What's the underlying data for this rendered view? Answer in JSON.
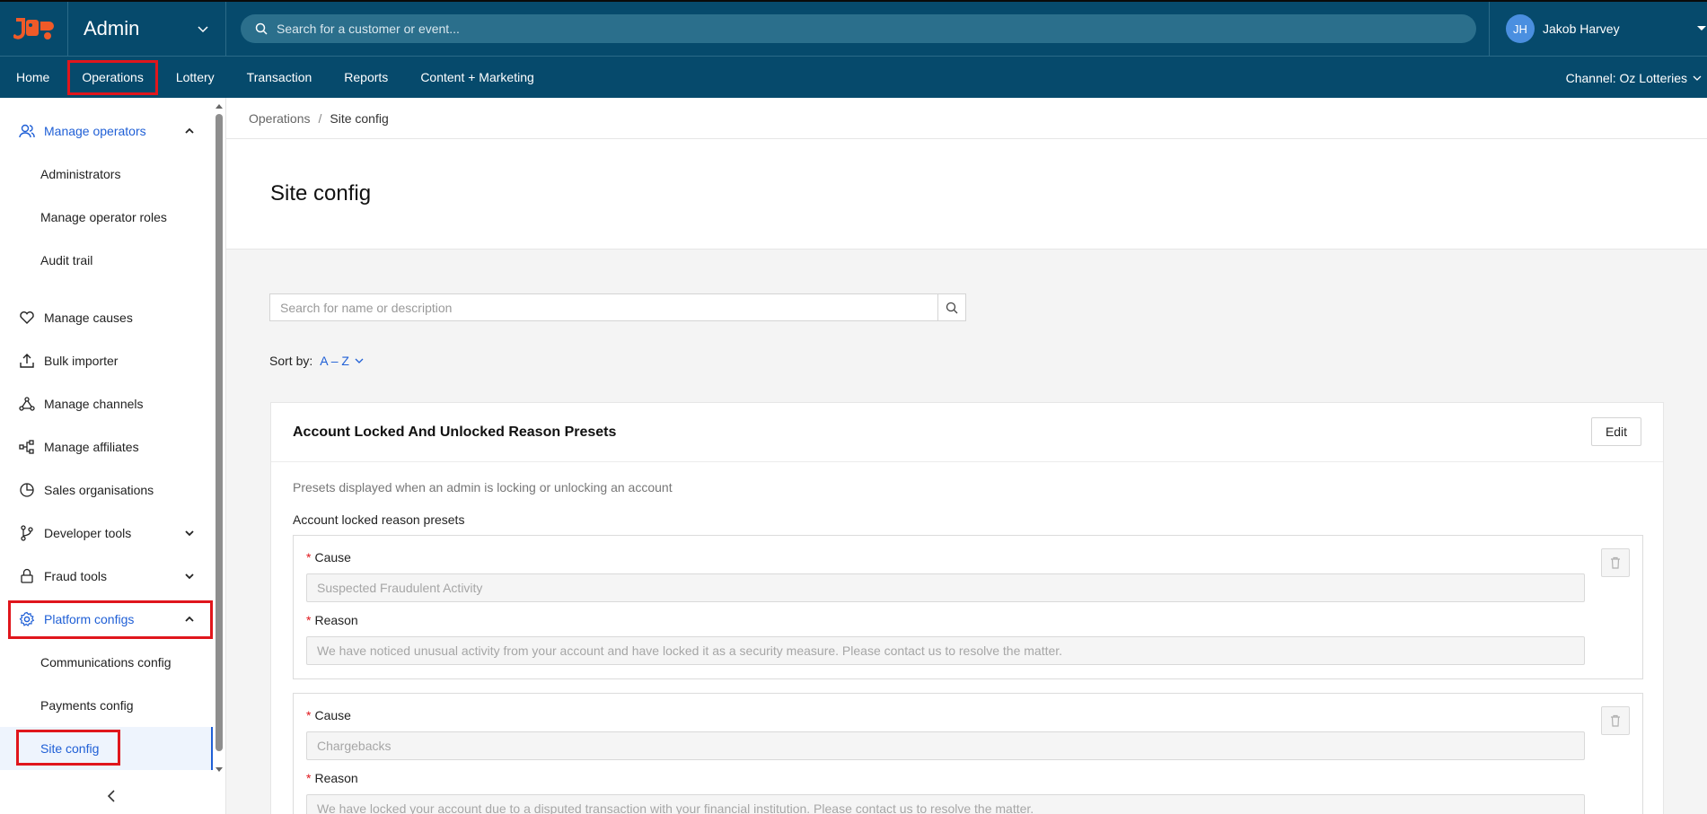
{
  "colors": {
    "topbar": "#064a6c",
    "accent_blue": "#1f5fd6",
    "highlight_red": "#e0161c",
    "logo_orange": "#f05a28",
    "avatar": "#4a8fe0"
  },
  "header": {
    "app_title": "Admin",
    "search_placeholder": "Search for a customer or event...",
    "user": {
      "initials": "JH",
      "name": "Jakob Harvey"
    }
  },
  "nav": {
    "items": [
      "Home",
      "Operations",
      "Lottery",
      "Transaction",
      "Reports",
      "Content + Marketing"
    ],
    "channel": "Channel: Oz Lotteries"
  },
  "sidebar": {
    "items": [
      {
        "label": "Manage operators",
        "icon": "users-icon"
      },
      {
        "label": "Administrators"
      },
      {
        "label": "Manage operator roles"
      },
      {
        "label": "Audit trail"
      },
      {
        "label": "Manage causes",
        "icon": "heart-icon"
      },
      {
        "label": "Bulk importer",
        "icon": "upload-icon"
      },
      {
        "label": "Manage channels",
        "icon": "network-icon"
      },
      {
        "label": "Manage affiliates",
        "icon": "affiliate-icon"
      },
      {
        "label": "Sales organisations",
        "icon": "pie-chart-icon"
      },
      {
        "label": "Developer tools",
        "icon": "branch-icon"
      },
      {
        "label": "Fraud tools",
        "icon": "lock-icon"
      },
      {
        "label": "Platform configs",
        "icon": "gear-icon"
      },
      {
        "label": "Communications config"
      },
      {
        "label": "Payments config"
      },
      {
        "label": "Site config"
      }
    ]
  },
  "breadcrumb": {
    "parent": "Operations",
    "separator": "/",
    "current": "Site config"
  },
  "page": {
    "title": "Site config",
    "search_placeholder": "Search for name or description",
    "sort_label": "Sort by:",
    "sort_value": "A – Z"
  },
  "card": {
    "title": "Account Locked And Unlocked Reason Presets",
    "edit_label": "Edit",
    "description": "Presets displayed when an admin is locking or unlocking an account",
    "section_title": "Account locked reason presets",
    "presets": [
      {
        "cause_label": "Cause",
        "cause_value": "Suspected Fraudulent Activity",
        "reason_label": "Reason",
        "reason_value": "We have noticed unusual activity from your account and have locked it as a security measure. Please contact us to resolve the matter."
      },
      {
        "cause_label": "Cause",
        "cause_value": "Chargebacks",
        "reason_label": "Reason",
        "reason_value": "We have locked your account due to a disputed transaction with your financial institution. Please contact us to resolve the matter."
      }
    ]
  }
}
